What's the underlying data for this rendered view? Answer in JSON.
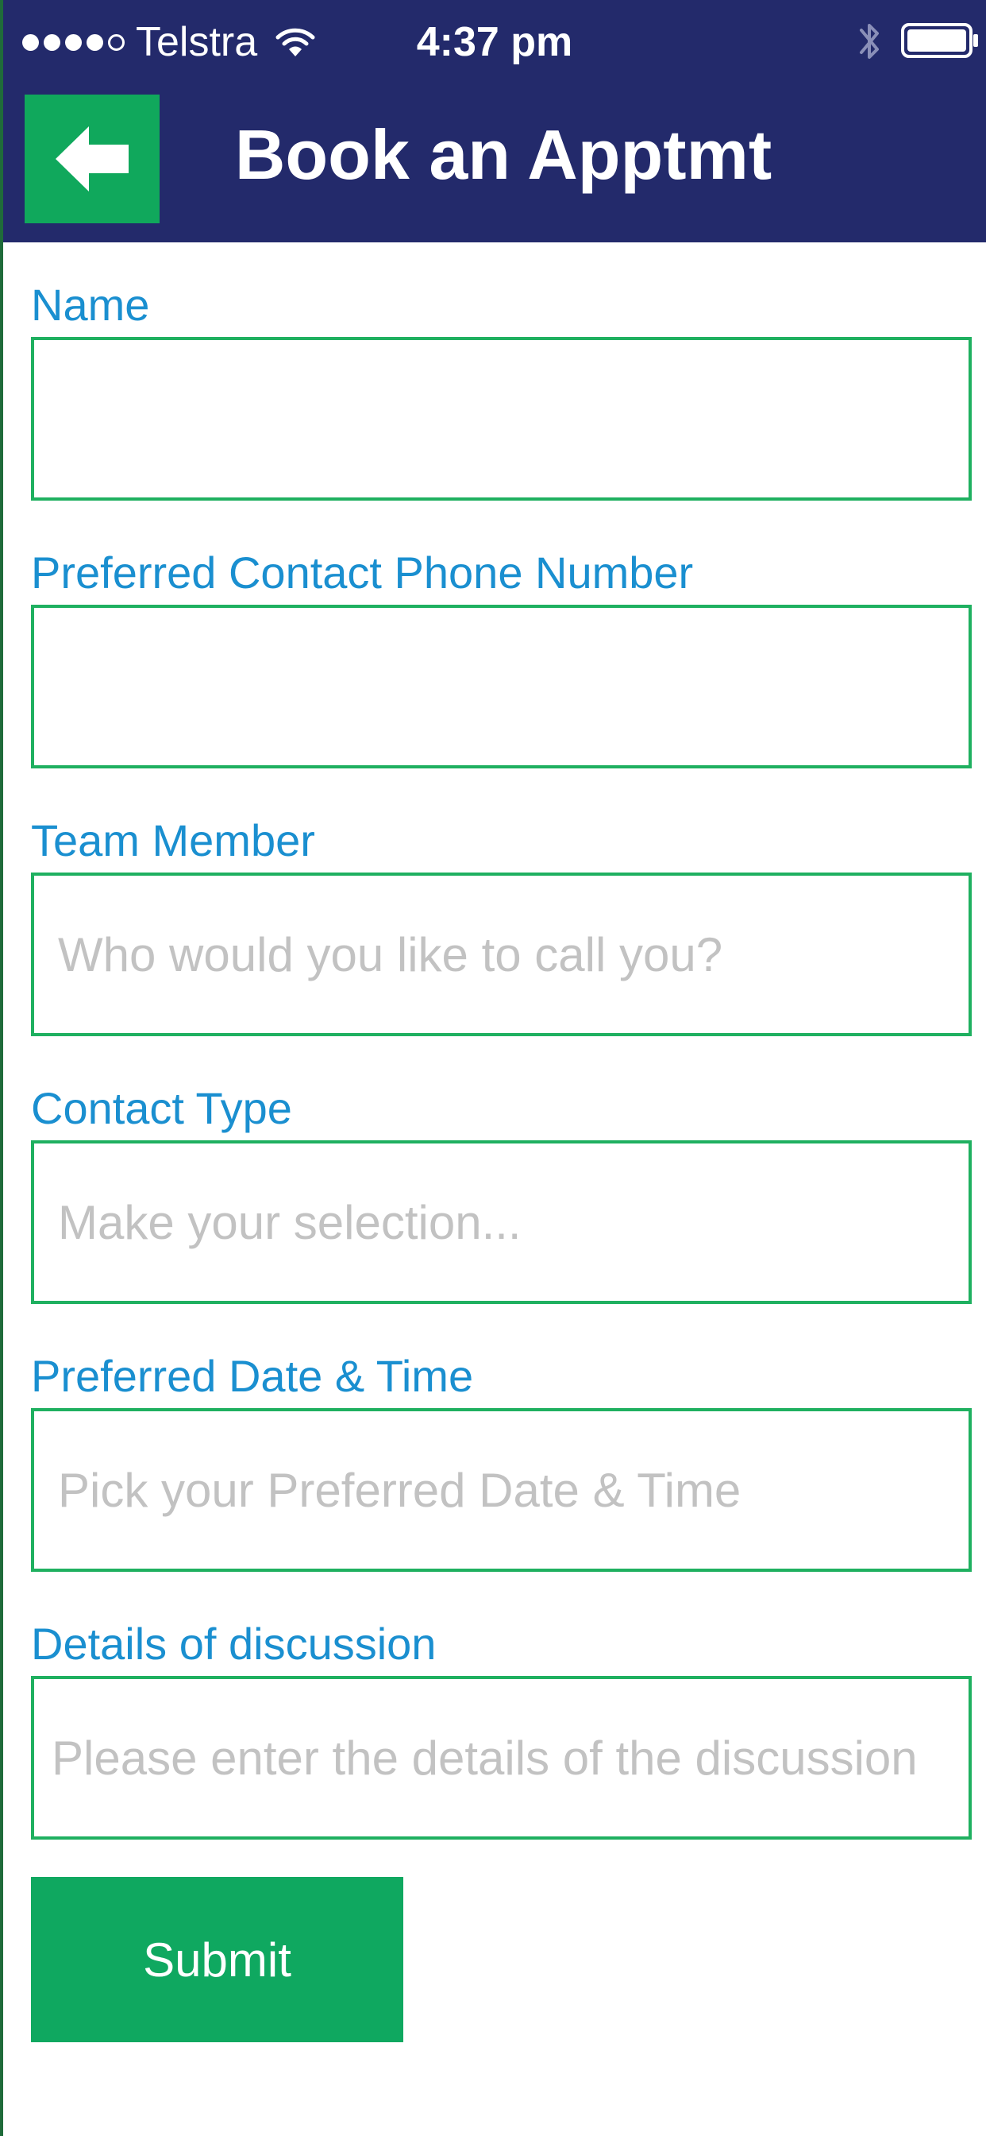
{
  "status_bar": {
    "carrier": "Telstra",
    "time": "4:37 pm",
    "signal_filled_dots": 4,
    "signal_total_dots": 5,
    "icons": [
      "wifi-icon",
      "bluetooth-icon",
      "battery-icon"
    ]
  },
  "header": {
    "title": "Book an Apptmt",
    "back_icon": "arrow-left-icon"
  },
  "form": {
    "fields": [
      {
        "label": "Name",
        "placeholder": "",
        "value": ""
      },
      {
        "label": "Preferred Contact Phone Number",
        "placeholder": "",
        "value": ""
      },
      {
        "label": "Team Member",
        "placeholder": "Who would you like to call you?",
        "value": ""
      },
      {
        "label": "Contact Type",
        "placeholder": "Make your selection...",
        "value": ""
      },
      {
        "label": "Preferred Date & Time",
        "placeholder": "Pick your Preferred Date & Time",
        "value": ""
      },
      {
        "label": "Details of discussion",
        "placeholder": "Please enter the details of the discussion",
        "value": ""
      }
    ],
    "submit_label": "Submit"
  },
  "colors": {
    "header_background": "#232a6b",
    "accent_green": "#10a85c",
    "label_blue": "#1a8fd0",
    "input_border": "#1fb060",
    "placeholder_gray": "#c2c2c2"
  }
}
